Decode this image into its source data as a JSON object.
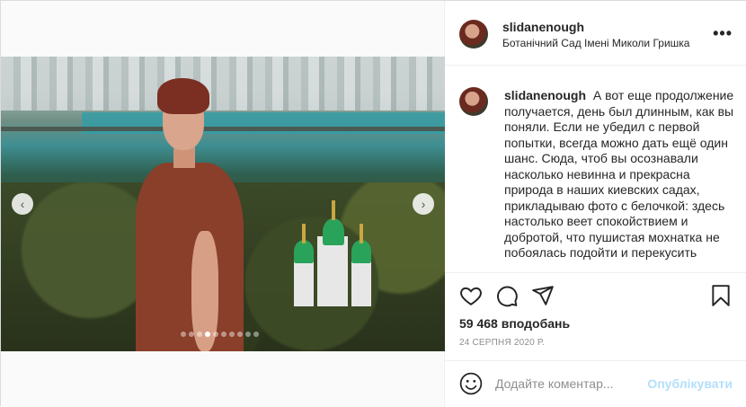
{
  "header": {
    "username": "slidanenough",
    "location": "Ботанічний Сад Імені Миколи Гришка",
    "more_label": "•••"
  },
  "caption": {
    "username": "slidanenough",
    "text": "А вот еще продолжение получается, день был длинным, как вы поняли. Если не убедил с первой попытки, всегда можно дать ещё один шанс. Сюда, чтоб вы осознавали насколько невинна и прекрасна природа в наших киевских садах, прикладываю фото с белочкой: здесь настолько веет спокойствием и добротой, что пушистая мохнатка не побоялась подойти и перекусить"
  },
  "carousel": {
    "prev_glyph": "‹",
    "next_glyph": "›",
    "slide_count": 10,
    "active_index": 3
  },
  "actions": {
    "icons": [
      "heart-icon",
      "comment-icon",
      "share-icon",
      "bookmark-icon"
    ]
  },
  "likes": "59 468 вподобань",
  "date": "24 СЕРПНЯ 2020 Р.",
  "comment_box": {
    "placeholder": "Додайте коментар...",
    "publish_label": "Опублікувати"
  },
  "colors": {
    "publish_disabled": "#b2dffc",
    "border": "#dbdbdb",
    "text": "#262626",
    "muted": "#8e8e8e"
  }
}
